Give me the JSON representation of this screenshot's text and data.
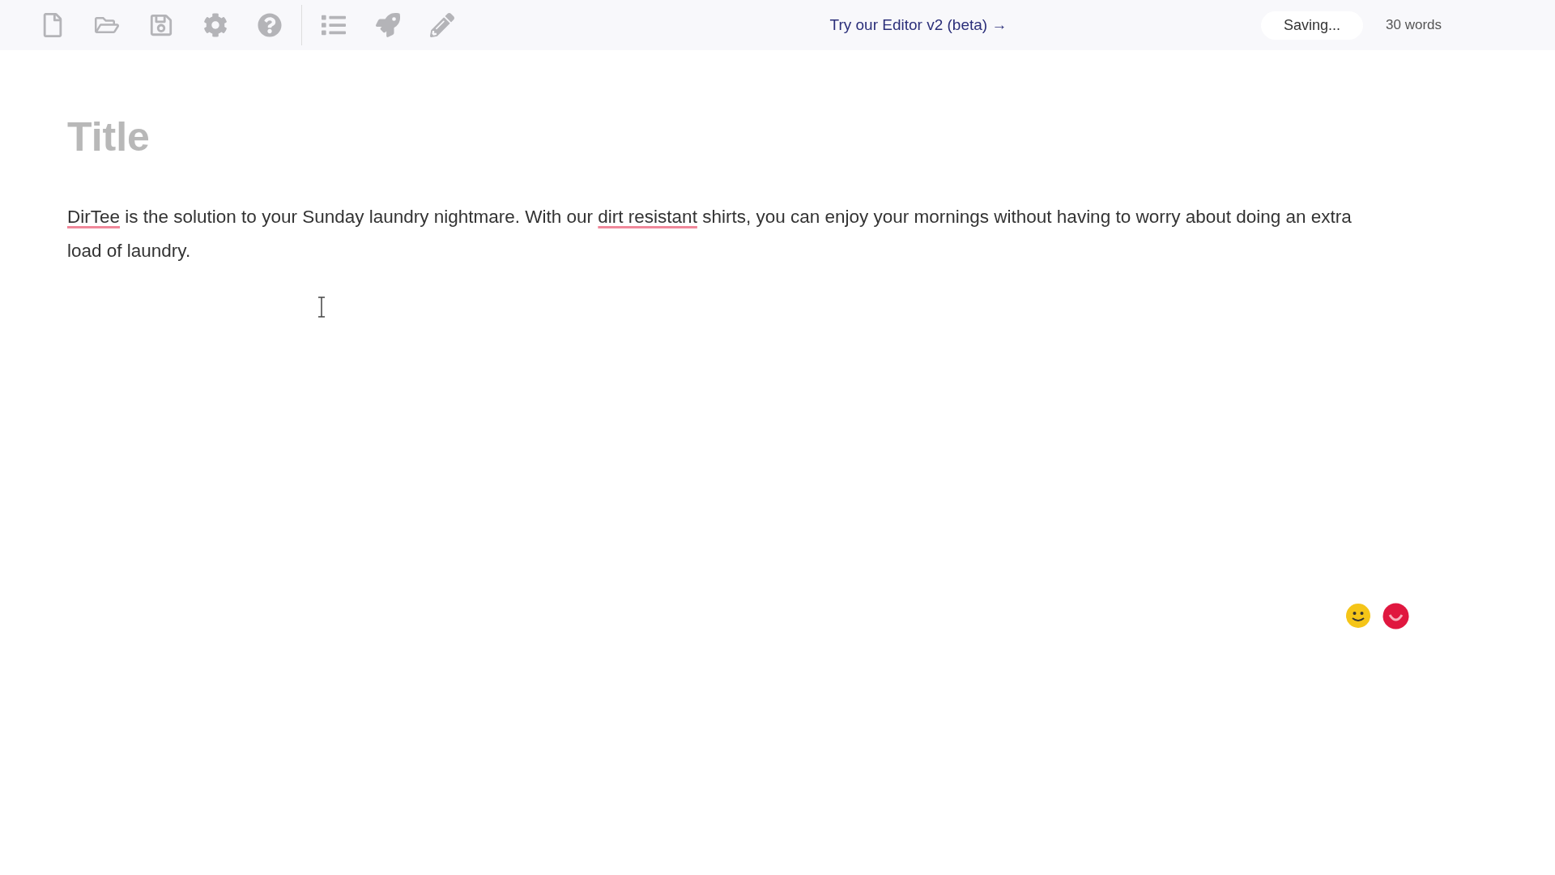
{
  "toolbar": {
    "banner_link": "Try our Editor v2 (beta) →",
    "status": "Saving...",
    "word_count": "30 words"
  },
  "editor": {
    "title_placeholder": "Title",
    "body": [
      {
        "text": "DirTee",
        "flagged": true
      },
      {
        "text": " is the solution to your Sunday laundry nightmare. With our ",
        "flagged": false
      },
      {
        "text": "dirt resistant",
        "flagged": true
      },
      {
        "text": " shirts, you can enjoy your mornings without having to worry about doing an extra load of laundry.",
        "flagged": false
      }
    ]
  }
}
